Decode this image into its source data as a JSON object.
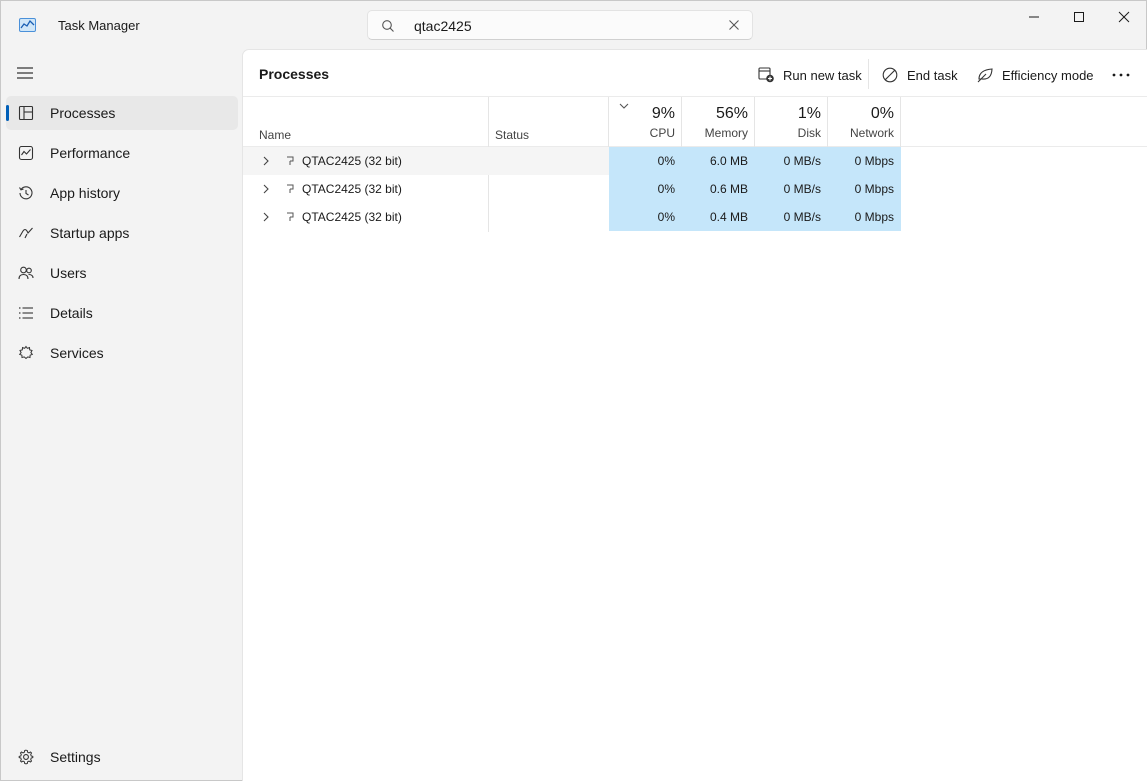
{
  "app": {
    "title": "Task Manager"
  },
  "search": {
    "value": "qtac2425"
  },
  "sidebar": {
    "items": [
      {
        "label": "Processes",
        "icon": "processes-icon",
        "active": true
      },
      {
        "label": "Performance",
        "icon": "performance-icon"
      },
      {
        "label": "App history",
        "icon": "app-history-icon"
      },
      {
        "label": "Startup apps",
        "icon": "startup-apps-icon"
      },
      {
        "label": "Users",
        "icon": "users-icon"
      },
      {
        "label": "Details",
        "icon": "details-icon"
      },
      {
        "label": "Services",
        "icon": "services-icon"
      }
    ],
    "settings_label": "Settings"
  },
  "main": {
    "title": "Processes",
    "toolbar": {
      "run_new_task": "Run new task",
      "end_task": "End task",
      "efficiency_mode": "Efficiency mode"
    },
    "columns": {
      "name": "Name",
      "status": "Status",
      "cpu": {
        "pct": "9%",
        "label": "CPU"
      },
      "memory": {
        "pct": "56%",
        "label": "Memory"
      },
      "disk": {
        "pct": "1%",
        "label": "Disk"
      },
      "network": {
        "pct": "0%",
        "label": "Network"
      }
    },
    "rows": [
      {
        "name": "QTAC2425 (32 bit)",
        "status": "",
        "cpu": "0%",
        "memory": "6.0 MB",
        "disk": "0 MB/s",
        "network": "0 Mbps"
      },
      {
        "name": "QTAC2425 (32 bit)",
        "status": "",
        "cpu": "0%",
        "memory": "0.6 MB",
        "disk": "0 MB/s",
        "network": "0 Mbps"
      },
      {
        "name": "QTAC2425 (32 bit)",
        "status": "",
        "cpu": "0%",
        "memory": "0.4 MB",
        "disk": "0 MB/s",
        "network": "0 Mbps"
      }
    ]
  },
  "colors": {
    "accent": "#005fb8",
    "heat": "#c5e6fa"
  }
}
